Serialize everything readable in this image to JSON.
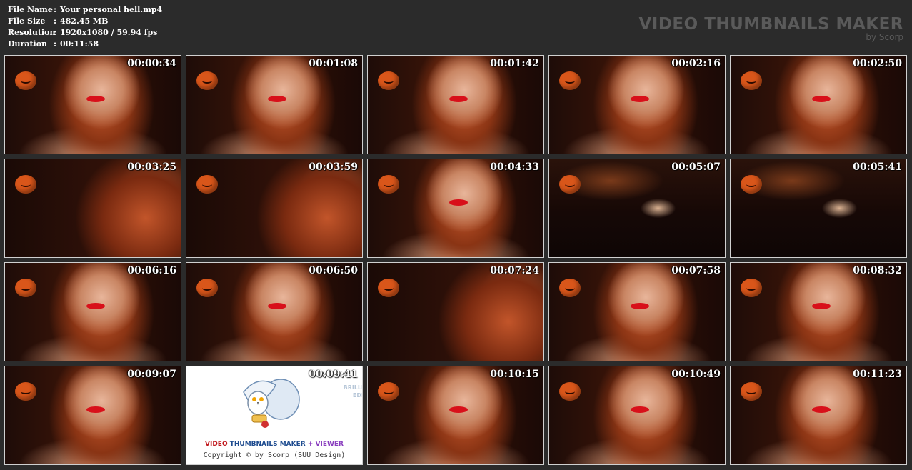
{
  "info": {
    "rows": [
      {
        "label": "File Name",
        "value": "Your personal hell.mp4"
      },
      {
        "label": "File Size",
        "value": "482.45 MB"
      },
      {
        "label": "Resolution",
        "value": "1920x1080 / 59.94 fps"
      },
      {
        "label": "Duration",
        "value": "00:11:58"
      }
    ]
  },
  "brand": {
    "title": "VIDEO THUMBNAILS MAKER",
    "subtitle": "by Scorp"
  },
  "thumbnails": [
    {
      "time": "00:00:34",
      "style": "face"
    },
    {
      "time": "00:01:08",
      "style": "face"
    },
    {
      "time": "00:01:42",
      "style": "face"
    },
    {
      "time": "00:02:16",
      "style": "face"
    },
    {
      "time": "00:02:50",
      "style": "face"
    },
    {
      "time": "00:03:25",
      "style": "side"
    },
    {
      "time": "00:03:59",
      "style": "side"
    },
    {
      "time": "00:04:33",
      "style": "face"
    },
    {
      "time": "00:05:07",
      "style": "dark"
    },
    {
      "time": "00:05:41",
      "style": "dark"
    },
    {
      "time": "00:06:16",
      "style": "face"
    },
    {
      "time": "00:06:50",
      "style": "face"
    },
    {
      "time": "00:07:24",
      "style": "side"
    },
    {
      "time": "00:07:58",
      "style": "face"
    },
    {
      "time": "00:08:32",
      "style": "face"
    },
    {
      "time": "00:09:07",
      "style": "face"
    },
    {
      "time": "00:09:41",
      "style": "logo"
    },
    {
      "time": "00:10:15",
      "style": "face"
    },
    {
      "time": "00:10:49",
      "style": "face"
    },
    {
      "time": "00:11:23",
      "style": "face"
    }
  ],
  "logo_tile": {
    "brilliant_line1": "BRILLI",
    "brilliant_line2": "EDI",
    "title_part1": "VIDEO ",
    "title_part2": "THUMBNAILS MAKER",
    "title_part3": " + VIEWER",
    "copyright": "Copyright © by Scorp (SUU Design)"
  }
}
